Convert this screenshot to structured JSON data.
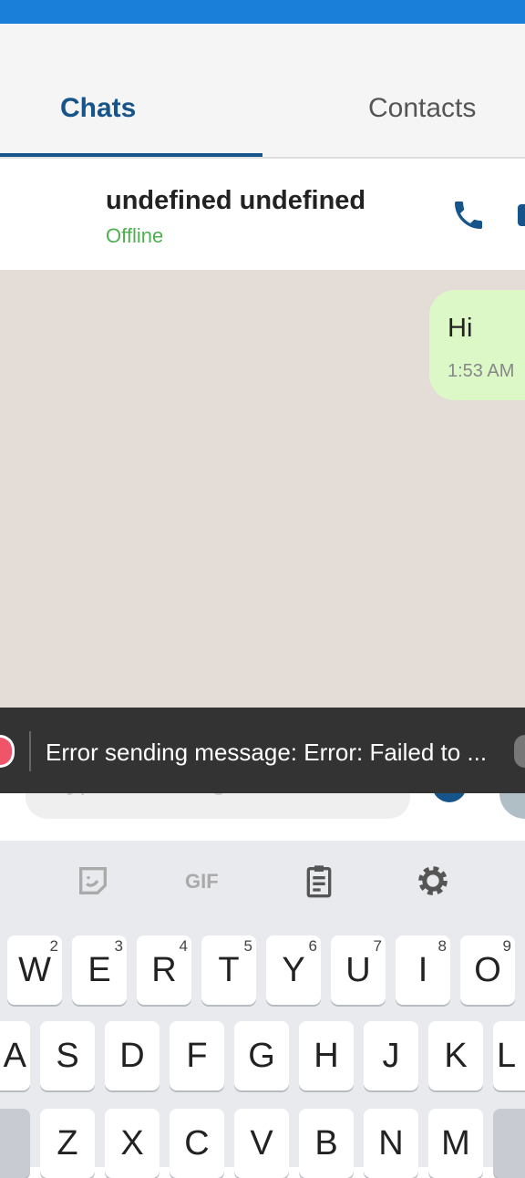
{
  "tabs": [
    {
      "label": "Chats",
      "active": true
    },
    {
      "label": "Contacts",
      "active": false
    }
  ],
  "contact": {
    "name": "undefined undefined",
    "status": "Offline"
  },
  "messages": [
    {
      "text": "Hi",
      "time": "1:53 AM",
      "outgoing": true
    }
  ],
  "composer": {
    "placeholder": "Type a message..."
  },
  "snackbar": {
    "text": "Error sending message: Error: Failed to ..."
  },
  "keyboard": {
    "toolbar": [
      "sticker-icon",
      "gif-icon",
      "clipboard-icon",
      "gear-icon"
    ],
    "gif_label": "GIF",
    "row1": [
      {
        "k": "W",
        "n": "2"
      },
      {
        "k": "E",
        "n": "3"
      },
      {
        "k": "R",
        "n": "4"
      },
      {
        "k": "T",
        "n": "5"
      },
      {
        "k": "Y",
        "n": "6"
      },
      {
        "k": "U",
        "n": "7"
      },
      {
        "k": "I",
        "n": "8"
      },
      {
        "k": "O",
        "n": "9"
      }
    ],
    "row2": [
      "A",
      "S",
      "D",
      "F",
      "G",
      "H",
      "J",
      "K",
      "L"
    ],
    "row3": [
      "Z",
      "X",
      "C",
      "V",
      "B",
      "N",
      "M"
    ]
  },
  "colors": {
    "accent": "#16548a",
    "status_online": "#4caf50",
    "bubble": "#dcf8c6",
    "chat_bg": "#e4dcd7"
  }
}
